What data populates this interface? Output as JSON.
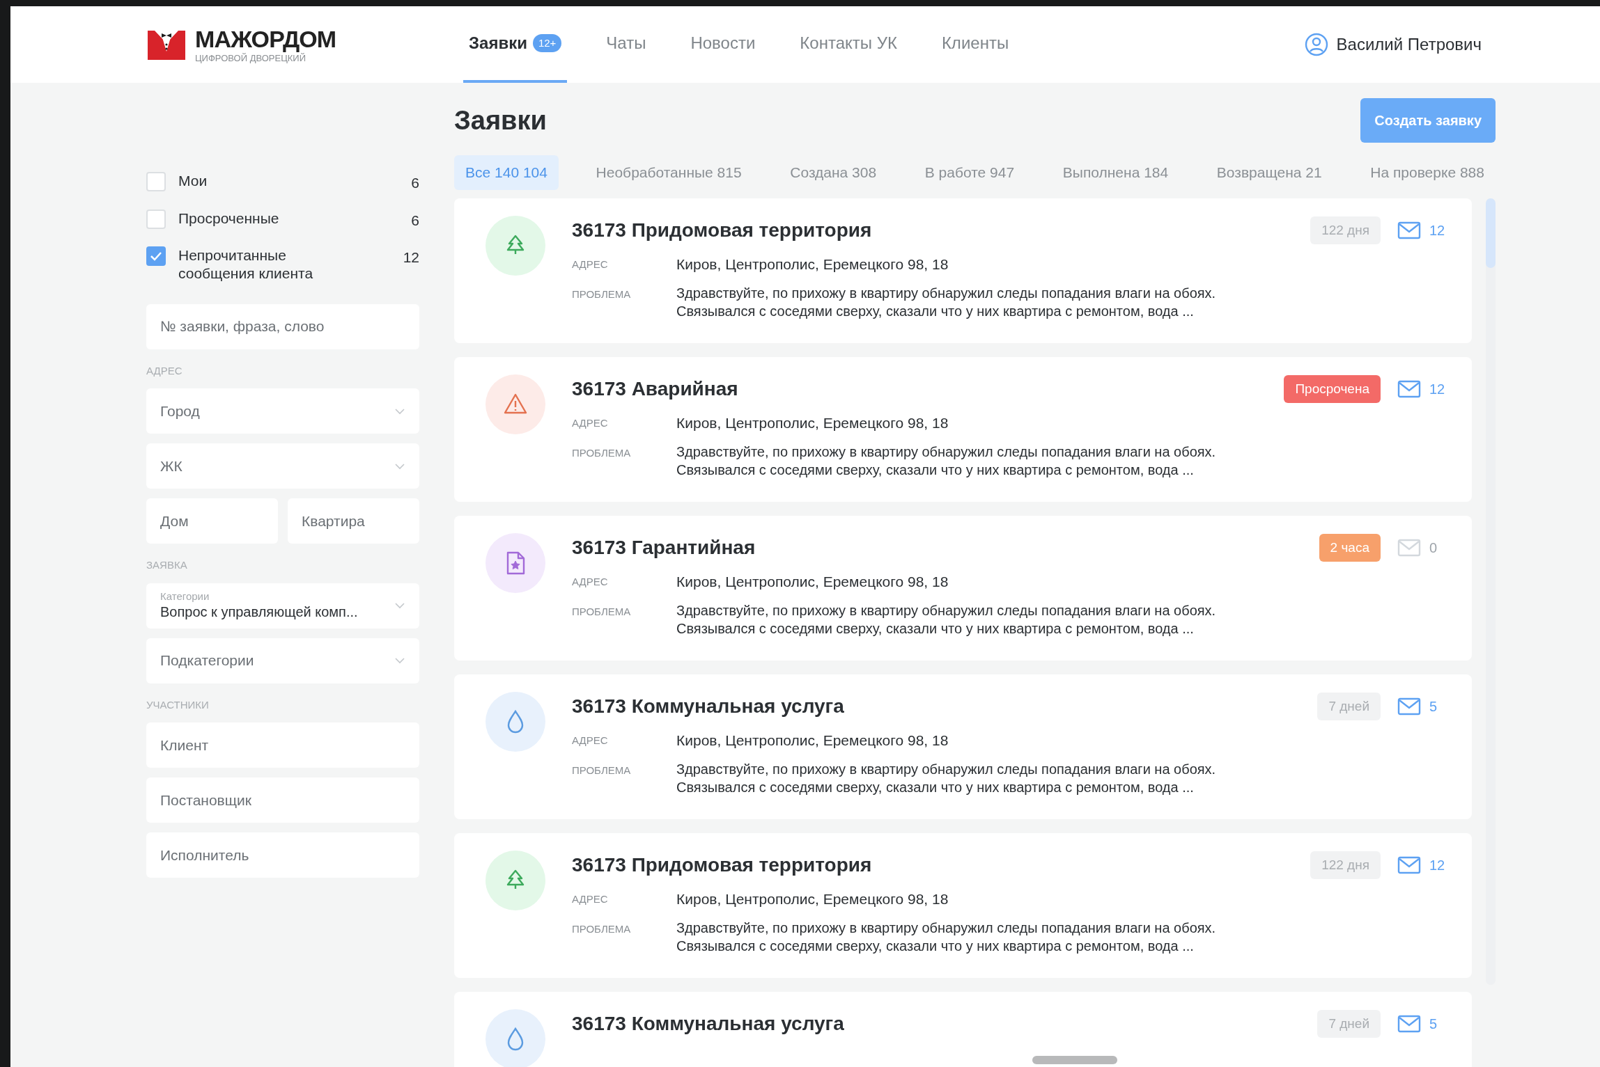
{
  "header": {
    "logo": {
      "title": "МАЖОРДОМ",
      "subtitle": "ЦИФРОВОЙ ДВОРЕЦКИЙ"
    },
    "nav": [
      {
        "label": "Заявки",
        "badge": "12+",
        "selected": true
      },
      {
        "label": "Чаты",
        "selected": false
      },
      {
        "label": "Новости",
        "selected": false
      },
      {
        "label": "Контакты УК",
        "selected": false
      },
      {
        "label": "Клиенты",
        "selected": false
      }
    ],
    "user": "Василий Петрович"
  },
  "sidebar": {
    "checkboxes": [
      {
        "label": "Мои",
        "count": "6",
        "checked": false
      },
      {
        "label": "Просроченные",
        "count": "6",
        "checked": false
      },
      {
        "label": "Непрочитанные сообщения клиента",
        "count": "12",
        "checked": true
      }
    ],
    "search": {
      "placeholder": "№ заявки, фраза, слово"
    },
    "sections": [
      {
        "title": "АДРЕС",
        "fields": [
          {
            "kind": "select",
            "placeholder": "Город"
          },
          {
            "kind": "select",
            "placeholder": "ЖК"
          },
          {
            "kind": "pair",
            "placeholders": [
              "Дом",
              "Квартира"
            ]
          }
        ]
      },
      {
        "title": "ЗАЯВКА",
        "fields": [
          {
            "kind": "labeled-select",
            "label": "Категории",
            "value": "Вопрос к управляющей комп..."
          },
          {
            "kind": "select",
            "placeholder": "Подкатегории"
          }
        ]
      },
      {
        "title": "УЧАСТНИКИ",
        "fields": [
          {
            "kind": "input",
            "placeholder": "Клиент"
          },
          {
            "kind": "input",
            "placeholder": "Постановщик"
          },
          {
            "kind": "input",
            "placeholder": "Исполнитель"
          }
        ]
      }
    ]
  },
  "main": {
    "title": "Заявки",
    "create_button": "Создать заявку",
    "filters": [
      {
        "label": "Все 140 104",
        "selected": true
      },
      {
        "label": "Необработанные 815",
        "selected": false
      },
      {
        "label": "Создана 308",
        "selected": false
      },
      {
        "label": "В работе 947",
        "selected": false
      },
      {
        "label": "Выполнена 184",
        "selected": false
      },
      {
        "label": "Возвращена 21",
        "selected": false
      },
      {
        "label": "На проверке 888",
        "selected": false
      }
    ],
    "tickets": [
      {
        "kind": "tree",
        "title": "36173 Придомовая территория",
        "badge": {
          "kind": "neutral",
          "text": "122 дня"
        },
        "messages": "12",
        "unread": true,
        "address_label": "АДРЕС",
        "address": "Киров,  Центрополис, Еремецкого 98, 18",
        "problem_label": "ПРОБЛЕМА",
        "problem": [
          "Здравствуйте, по прихожу в квартиру обнаружил следы попадания влаги на обоях.",
          "Связывался с соседями сверху, сказали что у них квартира с ремонтом, вода ..."
        ]
      },
      {
        "kind": "alert",
        "title": "36173 Аварийная",
        "badge": {
          "kind": "overdue",
          "text": "Просрочена"
        },
        "messages": "12",
        "unread": true,
        "address_label": "АДРЕС",
        "address": "Киров,  Центрополис, Еремецкого 98, 18",
        "problem_label": "ПРОБЛЕМА",
        "problem": [
          "Здравствуйте, по прихожу в квартиру обнаружил следы попадания влаги на обоях.",
          "Связывался с соседями сверху, сказали что у них квартира с ремонтом, вода ..."
        ]
      },
      {
        "kind": "document",
        "title": "36173 Гарантийная",
        "badge": {
          "kind": "warning",
          "text": "2 часа"
        },
        "messages": "0",
        "unread": false,
        "address_label": "АДРЕС",
        "address": "Киров,  Центрополис, Еремецкого 98, 18",
        "problem_label": "ПРОБЛЕМА",
        "problem": [
          "Здравствуйте, по прихожу в квартиру обнаружил следы попадания влаги на обоях.",
          "Связывался с соседями сверху, сказали что у них квартира с ремонтом, вода ..."
        ]
      },
      {
        "kind": "drop",
        "title": "36173 Коммунальная услуга",
        "badge": {
          "kind": "neutral",
          "text": "7 дней"
        },
        "messages": "5",
        "unread": true,
        "address_label": "АДРЕС",
        "address": "Киров,  Центрополис, Еремецкого 98, 18",
        "problem_label": "ПРОБЛЕМА",
        "problem": [
          "Здравствуйте, по прихожу в квартиру обнаружил следы попадания влаги на обоях.",
          "Связывался с соседями сверху, сказали что у них квартира с ремонтом, вода ..."
        ]
      },
      {
        "kind": "tree",
        "title": "36173 Придомовая территория",
        "badge": {
          "kind": "neutral",
          "text": "122 дня"
        },
        "messages": "12",
        "unread": true,
        "address_label": "АДРЕС",
        "address": "Киров,  Центрополис, Еремецкого 98, 18",
        "problem_label": "ПРОБЛЕМА",
        "problem": [
          "Здравствуйте, по прихожу в квартиру обнаружил следы попадания влаги на обоях.",
          "Связывался с соседями сверху, сказали что у них квартира с ремонтом, вода ..."
        ]
      },
      {
        "kind": "drop",
        "title": "36173 Коммунальная услуга",
        "badge": {
          "kind": "neutral",
          "text": "7 дней"
        },
        "messages": "5",
        "unread": true
      }
    ]
  }
}
